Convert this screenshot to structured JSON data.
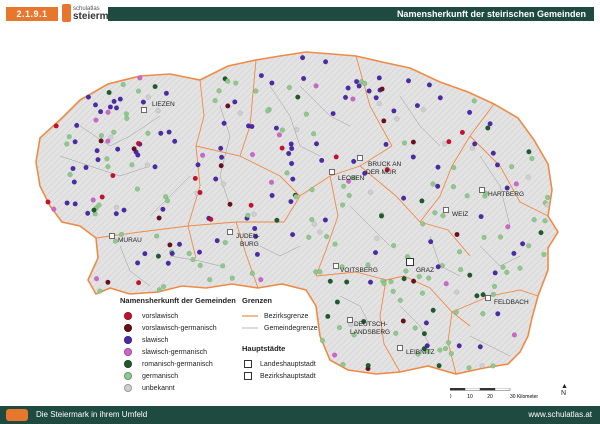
{
  "header": {
    "code": "2.1.9.1",
    "brand_small": "schulatlas",
    "brand_main": "steiermark",
    "title": "Namensherkunft der steirischen Gemeinden"
  },
  "colors": {
    "accent": "#e8772e",
    "header_bar": "#1f4a3f",
    "border_orange": "#ef8a46"
  },
  "legend": {
    "title": "Namensherkunft der Gemeinden",
    "items": [
      {
        "label": "vorslawisch",
        "color": "#c8102e"
      },
      {
        "label": "vorslawisch-germanisch",
        "color": "#6a0f1c"
      },
      {
        "label": "slawisch",
        "color": "#4b2aa8"
      },
      {
        "label": "slawisch-germanisch",
        "color": "#cc66cc"
      },
      {
        "label": "romanisch-germanisch",
        "color": "#1f5a2e"
      },
      {
        "label": "germanisch",
        "color": "#8cc98a"
      },
      {
        "label": "unbekannt",
        "color": "#cfcfcf"
      }
    ]
  },
  "borders": {
    "title": "Grenzen",
    "bezirk": "Bezirksgrenze",
    "gemeinde": "Gemeindegrenze"
  },
  "capitals": {
    "title": "Hauptstädte",
    "landes": "Landeshauptstadt",
    "bezirks": "Bezirkshauptstadt"
  },
  "cities": [
    {
      "label": "LIEZEN"
    },
    {
      "label": "MURAU"
    },
    {
      "label": "JUDEN-"
    },
    {
      "label": "BURG"
    },
    {
      "label": "LEOBEN"
    },
    {
      "label": "BRUCK AN"
    },
    {
      "label": "DER MUR"
    },
    {
      "label": "WEIZ"
    },
    {
      "label": "HARTBERG"
    },
    {
      "label": "GRAZ"
    },
    {
      "label": "VOITSBERG"
    },
    {
      "label": "DEUTSCH-"
    },
    {
      "label": "LANDSBERG"
    },
    {
      "label": "LEIBNITZ"
    },
    {
      "label": "FELDBACH"
    }
  ],
  "scale": {
    "labels": [
      "0",
      "10",
      "20",
      "30 Kilometer"
    ]
  },
  "north_label": "N",
  "footer": {
    "left": "Die Steiermark in ihrem Umfeld",
    "right": "www.schulatlas.at"
  }
}
